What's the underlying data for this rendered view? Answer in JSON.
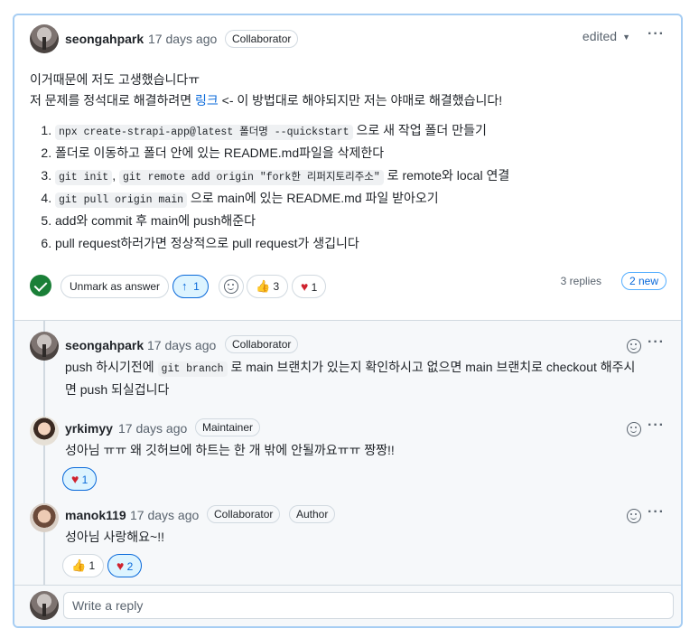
{
  "main_comment": {
    "author": "seongahpark",
    "time": "17 days ago",
    "badge": "Collaborator",
    "edited": "edited",
    "line1": "이거때문에 저도 고생했습니다ㅠ",
    "line2_before": "저 문제를 정석대로 해결하려면 ",
    "line2_link": "링크",
    "line2_after": " <- 이 방법대로 해야되지만 저는 야매로 해결했습니다!",
    "steps": [
      {
        "code": "npx create-strapi-app@latest 폴더명 --quickstart",
        "text": " 으로 새 작업 폴더 만들기"
      },
      {
        "text": "폴더로 이동하고 폴더 안에 있는 README.md파일을 삭제한다"
      },
      {
        "code": "git init",
        "sep": ", ",
        "code2": "git remote add origin \"fork한 리퍼지토리주소\"",
        "text": " 로 remote와 local 연결"
      },
      {
        "code": "git pull origin main",
        "text": " 으로 main에 있는 README.md 파일 받아오기"
      },
      {
        "text": "add와 commit 후 main에 push해준다"
      },
      {
        "text": "pull request하러가면 정상적으로 pull request가 생깁니다"
      }
    ],
    "unmark_label": "Unmark as answer",
    "upvotes": "1",
    "thumbs_count": "3",
    "heart_count": "1",
    "replies_label": "3 replies",
    "new_label": "2 new"
  },
  "replies": [
    {
      "author": "seongahpark",
      "time": "17 days ago",
      "badges": [
        "Collaborator"
      ],
      "text_before": "push 하시기전에 ",
      "code": "git branch",
      "text_after": " 로 main 브랜치가 있는지 확인하시고 없으면 main 브랜치로 checkout 해주시",
      "text_line2": "면 push 되실겁니다"
    },
    {
      "author": "yrkimyy",
      "time": "17 days ago",
      "badges": [
        "Maintainer"
      ],
      "text": "성아님 ㅠㅠ 왜 깃허브에 하트는 한 개 밖에 안될까요ㅠㅠ 짱짱!!",
      "heart_count": "1"
    },
    {
      "author": "manok119",
      "time": "17 days ago",
      "badges": [
        "Collaborator",
        "Author"
      ],
      "text": "성아님 사랑해요~!!",
      "thumbs_count": "1",
      "heart_count": "2"
    }
  ],
  "composer": {
    "placeholder": "Write a reply"
  },
  "icons": {
    "check": "check-circle-icon",
    "arrow": "arrow-up-icon",
    "smile": "smiley-icon",
    "thumbs": "thumbs-up-icon",
    "heart": "heart-icon",
    "kebab": "kebab-horizontal-icon"
  },
  "colors": {
    "accent": "#0969da",
    "answer_green": "#1a7f37",
    "selected_border": "#a6cdf3",
    "heart": "#cf222e"
  }
}
